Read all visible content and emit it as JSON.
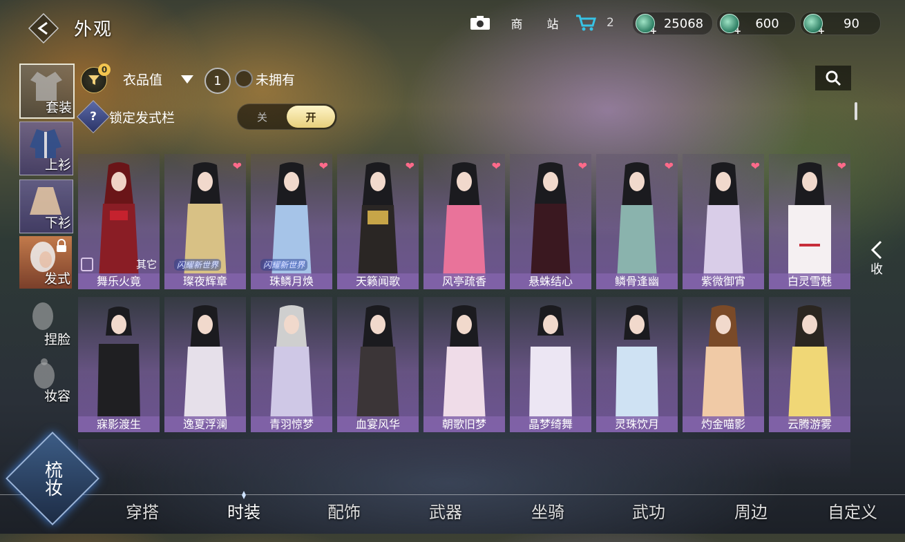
{
  "header": {
    "title": "外观"
  },
  "top_icons": [
    {
      "name": "camera-icon",
      "glyph": "📷"
    },
    {
      "name": "shop-icon",
      "glyph": "商"
    },
    {
      "name": "station-icon",
      "glyph": "站"
    }
  ],
  "cart": {
    "count": "2"
  },
  "currencies": [
    {
      "name": "currency-jade",
      "value": "25068"
    },
    {
      "name": "currency-coin",
      "value": "600"
    },
    {
      "name": "currency-ticket",
      "value": "90"
    }
  ],
  "left_nav": [
    {
      "label": "套装",
      "selected": true
    },
    {
      "label": "上衫",
      "selected": false
    },
    {
      "label": "下衫",
      "selected": false
    },
    {
      "label": "发式",
      "selected": false
    },
    {
      "label": "捏脸",
      "selected": false
    },
    {
      "label": "妆容",
      "selected": false
    }
  ],
  "filter": {
    "badge": "0",
    "sort_label": "衣品值",
    "info": "1",
    "owned_label": "未拥有"
  },
  "lock_hair": {
    "label": "锁定发式栏",
    "help": "?",
    "off": "关",
    "on": "开"
  },
  "items_row1": [
    {
      "label": "舞乐火竟",
      "other": "其它",
      "heart": false
    },
    {
      "label": "璨夜辉章",
      "tag": "闪耀新世界",
      "heart": true
    },
    {
      "label": "珠鳞月焕",
      "tag": "闪耀新世界",
      "heart": true
    },
    {
      "label": "天籁闻歌",
      "heart": true
    },
    {
      "label": "风亭疏香",
      "heart": true
    },
    {
      "label": "悬蛛结心",
      "heart": true
    },
    {
      "label": "鳞骨逢幽",
      "heart": true
    },
    {
      "label": "紫微御宵",
      "heart": true
    },
    {
      "label": "白灵雪魅",
      "heart": true
    }
  ],
  "items_row2": [
    {
      "label": "寐影渡生"
    },
    {
      "label": "逸夏浮澜"
    },
    {
      "label": "青羽惊梦"
    },
    {
      "label": "血宴风华"
    },
    {
      "label": "朝歌旧梦"
    },
    {
      "label": "晶梦绮舞"
    },
    {
      "label": "灵珠饮月"
    },
    {
      "label": "灼金喵影"
    },
    {
      "label": "云腾游雾"
    }
  ],
  "collapse_label": "收",
  "comb_label": "梳妆",
  "bottom_tabs": [
    "穿搭",
    "时装",
    "配饰",
    "武器",
    "坐骑",
    "武功",
    "周边",
    "自定义"
  ],
  "active_tab": "时装",
  "colors": {
    "accent_gold": "#f3c54f",
    "card_label": "#8264aa",
    "heart": "#ff6a8a"
  }
}
